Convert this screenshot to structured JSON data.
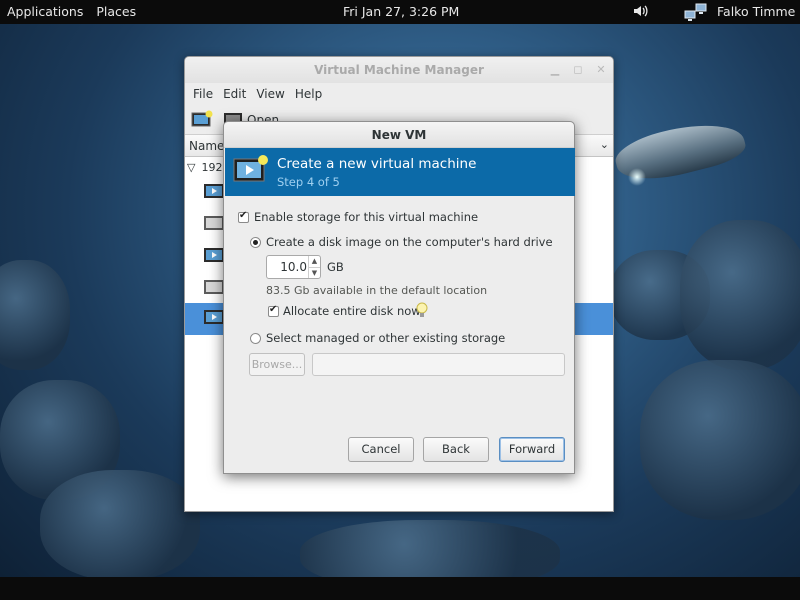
{
  "topbar": {
    "applications": "Applications",
    "places": "Places",
    "clock": "Fri Jan 27,  3:26 PM",
    "user": "Falko Timme"
  },
  "main_window": {
    "title": "Virtual Machine Manager",
    "menu": [
      "File",
      "Edit",
      "View",
      "Help"
    ],
    "toolbar_open": "Open",
    "column_name": "Name",
    "host": "192."
  },
  "dialog": {
    "title": "New VM",
    "banner_title": "Create a new virtual machine",
    "banner_step": "Step 4 of 5",
    "enable_storage": "Enable storage for this virtual machine",
    "create_disk": "Create a disk image on the computer's hard drive",
    "disk_size": "10.0",
    "disk_unit": "GB",
    "available": "83.5 Gb available in the default location",
    "allocate": "Allocate entire disk now",
    "select_managed": "Select managed or other existing storage",
    "browse": "Browse...",
    "cancel": "Cancel",
    "back": "Back",
    "forward": "Forward"
  }
}
